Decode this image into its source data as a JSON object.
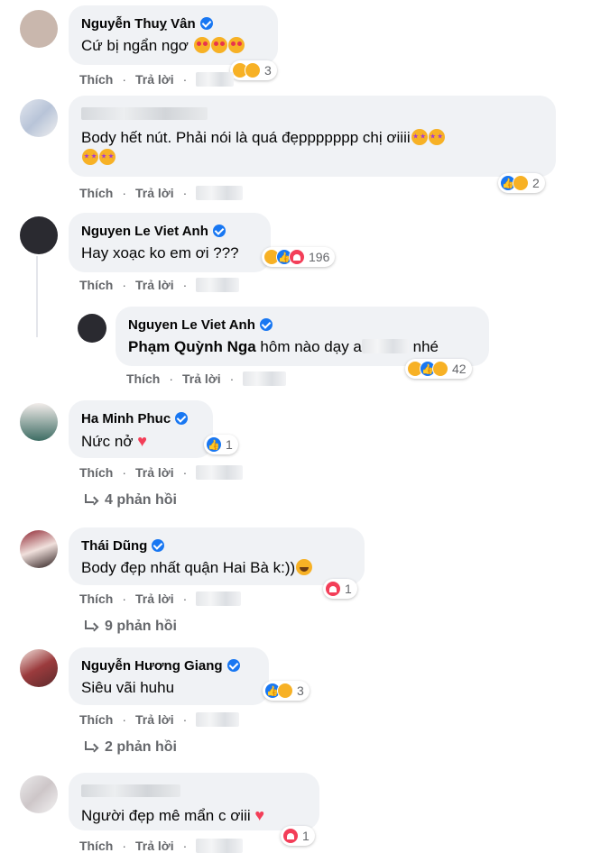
{
  "actions": {
    "like": "Thích",
    "reply": "Trả lời",
    "sep": "·"
  },
  "comments": [
    {
      "name": "Nguyễn Thuỵ Vân",
      "verified": true,
      "text": "Cứ bị ngẩn ngơ",
      "reactions": [
        "haha",
        "care"
      ],
      "reaction_count": "3"
    },
    {
      "name": "",
      "verified": false,
      "text": "Body hết nút. Phải nói là quá đẹppppppp chị ơiiii",
      "reactions": [
        "like",
        "care"
      ],
      "reaction_count": "2"
    },
    {
      "name": "Nguyen Le Viet Anh",
      "verified": true,
      "text": "Hay xoạc ko em ơi ???",
      "reactions": [
        "haha",
        "like",
        "love"
      ],
      "reaction_count": "196"
    },
    {
      "name": "Nguyen Le Viet Anh",
      "verified": true,
      "mention": "Phạm Quỳnh Nga",
      "text_after": " hôm nào dạy a",
      "text_end": " nhé",
      "reactions": [
        "haha",
        "like",
        "wow"
      ],
      "reaction_count": "42"
    },
    {
      "name": "Ha Minh Phuc",
      "verified": true,
      "text": "Nức nở",
      "reactions": [
        "like"
      ],
      "reaction_count": "1",
      "replies": "4 phản hồi"
    },
    {
      "name": "Thái Dũng",
      "verified": true,
      "text": "Body đẹp nhất quận Hai Bà k:))",
      "reactions": [
        "love"
      ],
      "reaction_count": "1",
      "replies": "9 phản hồi"
    },
    {
      "name": "Nguyễn Hương Giang",
      "verified": true,
      "text": "Siêu vãi huhu",
      "reactions": [
        "like",
        "care"
      ],
      "reaction_count": "3",
      "replies": "2 phản hồi"
    },
    {
      "name": "",
      "verified": false,
      "text": "Người đẹp mê mẩn c ơiii",
      "reactions": [
        "love"
      ],
      "reaction_count": "1"
    }
  ],
  "colors": {
    "bubble": "#f0f2f5",
    "verified": "#1877f2",
    "muted": "#65676b",
    "love": "#f33e58",
    "haha": "#f7b125"
  }
}
